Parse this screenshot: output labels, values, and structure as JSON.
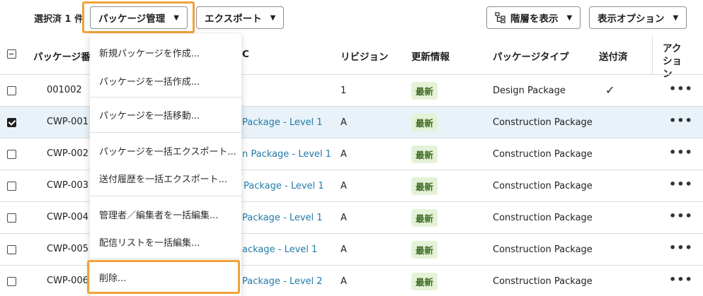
{
  "toolbar": {
    "selected_count": "選択済 1 件",
    "package_manage_label": "パッケージ管理",
    "export_label": "エクスポート",
    "show_hierarchy_label": "階層を表示",
    "display_options_label": "表示オプション",
    "highlight_color": "#f0a23a"
  },
  "table": {
    "headers": {
      "package_number": "パッケージ番号",
      "name_partial": "C",
      "revision": "リビジョン",
      "update_info": "更新情報",
      "package_type": "パッケージタイプ",
      "sent": "送付済",
      "action": "アクション"
    },
    "rows": [
      {
        "id": "001002",
        "name": "",
        "revision": "1",
        "status": "最新",
        "type": "Design Package",
        "sent": "✓",
        "selected": false
      },
      {
        "id": "CWP-001",
        "name": "Package - Level 1",
        "revision": "A",
        "status": "最新",
        "type": "Construction Package",
        "sent": "",
        "selected": true
      },
      {
        "id": "CWP-002",
        "name": "n Package  - Level 1",
        "revision": "A",
        "status": "最新",
        "type": "Construction Package",
        "sent": "",
        "selected": false
      },
      {
        "id": "CWP-003",
        "name": "Package  - Level 1",
        "revision": "A",
        "status": "最新",
        "type": "Construction Package",
        "sent": "",
        "selected": false
      },
      {
        "id": "CWP-004",
        "name": "Package - Level 1",
        "revision": "A",
        "status": "最新",
        "type": "Construction Package",
        "sent": "",
        "selected": false
      },
      {
        "id": "CWP-005",
        "name": "ackage  - Level 1",
        "revision": "A",
        "status": "最新",
        "type": "Construction Package",
        "sent": "",
        "selected": false
      },
      {
        "id": "CWP-006",
        "name": "Package - Level 2",
        "revision": "A",
        "status": "最新",
        "type": "Construction Package",
        "sent": "",
        "selected": false
      }
    ],
    "action_glyph": "•••",
    "link_color": "#227aa8",
    "status_bg": "#e4f2d8"
  },
  "menu": {
    "items": [
      "新規パッケージを作成...",
      "パッケージを一括作成...",
      "パッケージを一括移動...",
      "パッケージを一括エクスポート...",
      "送付履歴を一括エクスポート...",
      "管理者／編集者を一括編集...",
      "配信リストを一括編集...",
      "削除..."
    ]
  }
}
